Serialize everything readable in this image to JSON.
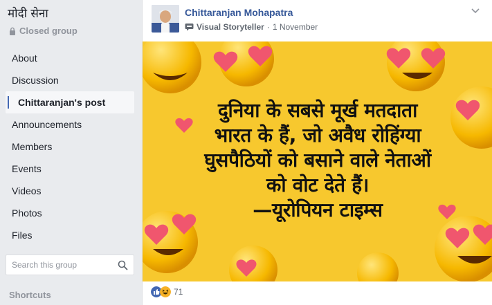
{
  "group": {
    "title": "मोदी सेना",
    "privacy": "Closed group"
  },
  "sidebar": {
    "items": [
      {
        "label": "About"
      },
      {
        "label": "Discussion"
      },
      {
        "label": "Chittaranjan's post"
      },
      {
        "label": "Announcements"
      },
      {
        "label": "Members"
      },
      {
        "label": "Events"
      },
      {
        "label": "Videos"
      },
      {
        "label": "Photos"
      },
      {
        "label": "Files"
      }
    ],
    "active_index": 2,
    "search_placeholder": "Search this group",
    "shortcuts": "Shortcuts"
  },
  "post": {
    "author": "Chittaranjan Mohapatra",
    "badge": "Visual Storyteller",
    "separator": "·",
    "date": "1 November",
    "quote_lines": [
      "दुनिया के सबसे मूर्ख मतदाता",
      "भारत के हैं, जो अवैध रोहिंग्या",
      "घुसपैठियों को बसाने वाले नेताओं",
      "को वोट देते हैं।",
      "—यूरोपियन टाइम्स"
    ],
    "reaction_count": "71"
  },
  "colors": {
    "link": "#365899",
    "image_bg": "#f7c82e",
    "accent": "#4267b2"
  }
}
